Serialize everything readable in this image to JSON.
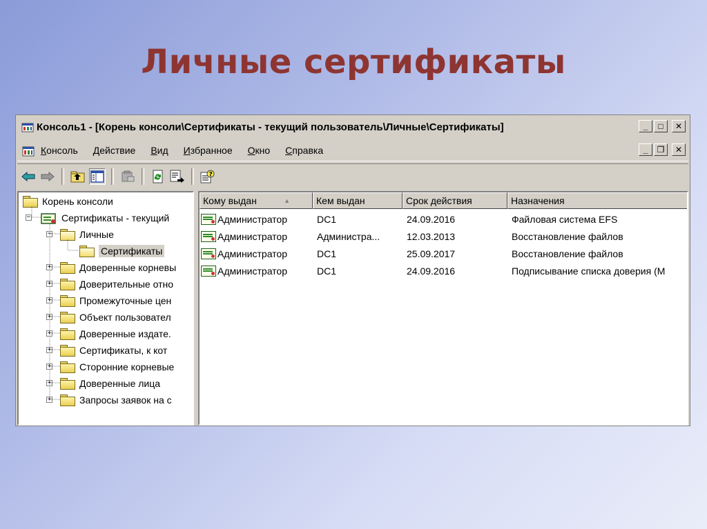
{
  "slide": {
    "title": "Личные сертификаты"
  },
  "window": {
    "title": "Консоль1 - [Корень консоли\\Сертификаты - текущий пользователь\\Личные\\Сертификаты]",
    "controls": {
      "minimize": "_",
      "maximize": "□",
      "close": "✕"
    },
    "mdi_controls": {
      "minimize": "_",
      "restore": "❐",
      "close": "✕"
    }
  },
  "menu": {
    "items": [
      {
        "underline": "К",
        "rest": "онсоль"
      },
      {
        "underline": "Д",
        "rest": "ействие"
      },
      {
        "underline": "В",
        "rest": "ид"
      },
      {
        "underline": "И",
        "rest": "збранное"
      },
      {
        "underline": "О",
        "rest": "кно"
      },
      {
        "underline": "С",
        "rest": "правка"
      }
    ]
  },
  "toolbar": {
    "icons": [
      "back-arrow-icon",
      "forward-arrow-icon",
      "up-folder-icon",
      "show-hide-tree-icon",
      "delete-icon",
      "refresh-icon",
      "export-list-icon",
      "help-icon"
    ]
  },
  "tree": {
    "items": [
      {
        "label": "Корень консоли",
        "level": 0,
        "expander": ""
      },
      {
        "label": "Сертификаты - текущий",
        "level": 1,
        "expander": "−"
      },
      {
        "label": "Личные",
        "level": 2,
        "expander": "−"
      },
      {
        "label": "Сертификаты",
        "level": 3,
        "expander": "",
        "selected": true
      },
      {
        "label": "Доверенные корневы",
        "level": 2,
        "expander": "+"
      },
      {
        "label": "Доверительные отно",
        "level": 2,
        "expander": "+"
      },
      {
        "label": "Промежуточные цен",
        "level": 2,
        "expander": "+"
      },
      {
        "label": "Объект пользовател",
        "level": 2,
        "expander": "+"
      },
      {
        "label": "Доверенные издате.",
        "level": 2,
        "expander": "+"
      },
      {
        "label": "Сертификаты, к кот",
        "level": 2,
        "expander": "+"
      },
      {
        "label": "Сторонние корневые",
        "level": 2,
        "expander": "+"
      },
      {
        "label": "Доверенные лица",
        "level": 2,
        "expander": "+"
      },
      {
        "label": "Запросы заявок на с",
        "level": 2,
        "expander": "+"
      }
    ]
  },
  "list": {
    "columns": [
      "Кому выдан",
      "Кем выдан",
      "Срок действия",
      "Назначения"
    ],
    "sort_indicator": "▲",
    "rows": [
      [
        "Администратор",
        "DC1",
        "24.09.2016",
        "Файловая система EFS"
      ],
      [
        "Администратор",
        "Администра...",
        "12.03.2013",
        "Восстановление файлов"
      ],
      [
        "Администратор",
        "DC1",
        "25.09.2017",
        "Восстановление файлов"
      ],
      [
        "Администратор",
        "DC1",
        "24.09.2016",
        "Подписывание списка доверия (М"
      ]
    ]
  },
  "colors": {
    "title": "#8e3532",
    "window_face": "#d4d0c8"
  }
}
